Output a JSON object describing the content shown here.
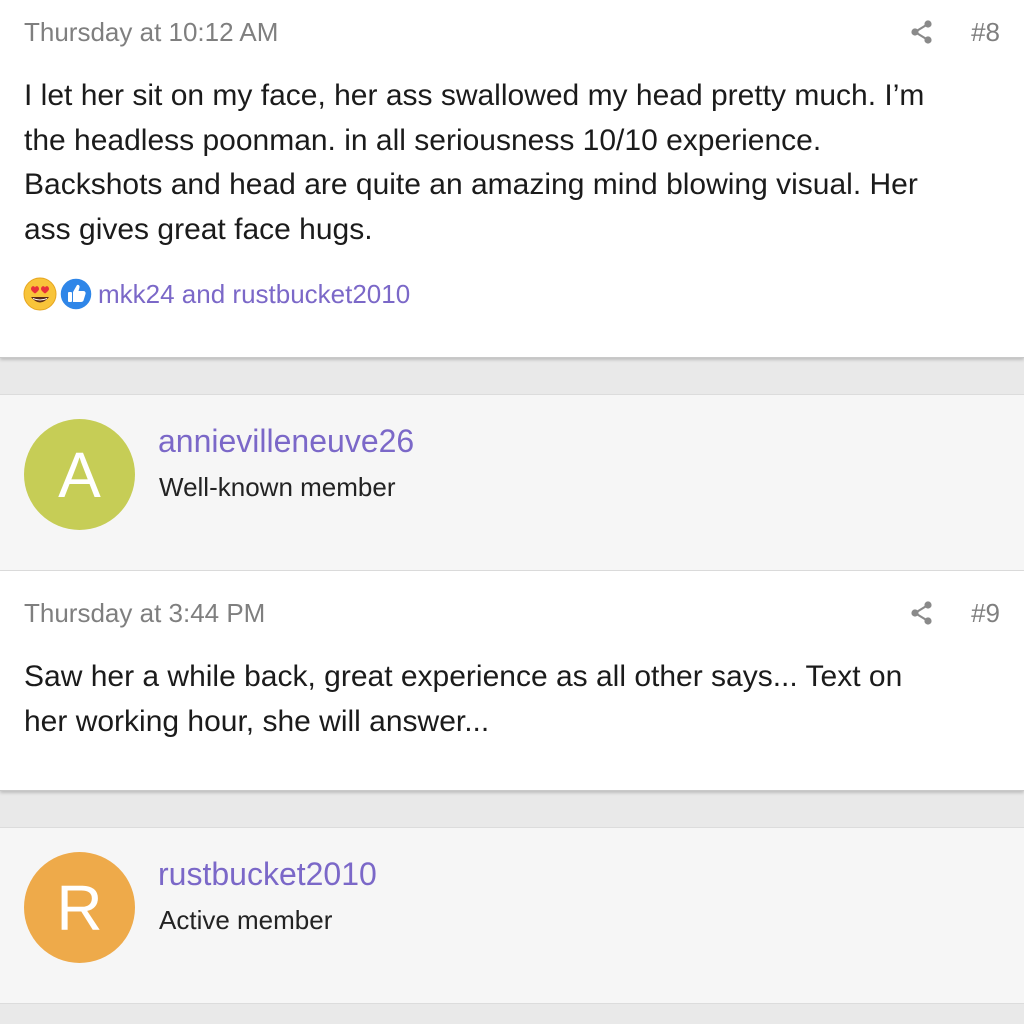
{
  "post8": {
    "date": "Thursday at 10:12 AM",
    "number": "#8",
    "body_lines": [
      "I let her sit on my face, her ass swallowed my head pretty much. I’m",
      "the headless poonman. in all seriousness 10/10 experience.",
      "Backshots and head are quite an amazing mind blowing visual. Her",
      "ass gives great face hugs."
    ],
    "reactions": {
      "icons": [
        "heart-eyes-emoji-icon",
        "thumbs-up-icon"
      ],
      "users": "mkk24 and rustbucket2010"
    }
  },
  "member1": {
    "initial": "A",
    "name": "annievilleneuve26",
    "role": "Well-known member",
    "avatar_color": "#c6cd56"
  },
  "post9": {
    "date": "Thursday at 3:44 PM",
    "number": "#9",
    "body_lines": [
      "Saw her a while back, great experience as all other says... Text on",
      "her working hour, she will answer..."
    ]
  },
  "member2": {
    "initial": "R",
    "name": "rustbucket2010",
    "role": "Active member",
    "avatar_color": "#eeaa4a"
  },
  "colors": {
    "link": "#7b68c8",
    "meta": "#7f7f7f"
  }
}
